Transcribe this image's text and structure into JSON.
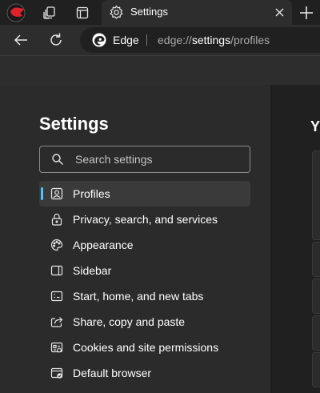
{
  "tab": {
    "title": "Settings"
  },
  "address": {
    "site_name": "Edge",
    "url_scheme": "edge://",
    "url_page": "settings",
    "url_path": "/profiles"
  },
  "sidebar": {
    "title": "Settings",
    "search_placeholder": "Search settings",
    "items": [
      {
        "label": "Profiles",
        "icon": "profile-icon",
        "active": true
      },
      {
        "label": "Privacy, search, and services",
        "icon": "lock-icon"
      },
      {
        "label": "Appearance",
        "icon": "palette-icon"
      },
      {
        "label": "Sidebar",
        "icon": "sidebar-icon"
      },
      {
        "label": "Start, home, and new tabs",
        "icon": "home-tabs-icon"
      },
      {
        "label": "Share, copy and paste",
        "icon": "share-icon"
      },
      {
        "label": "Cookies and site permissions",
        "icon": "cookies-icon"
      },
      {
        "label": "Default browser",
        "icon": "default-browser-icon"
      }
    ]
  },
  "main": {
    "heading": "Y"
  },
  "colors": {
    "accent": "#4cc2ff",
    "pane": "#2b2b2b",
    "chrome": "#202020",
    "toolbar": "#2d2d2d"
  }
}
